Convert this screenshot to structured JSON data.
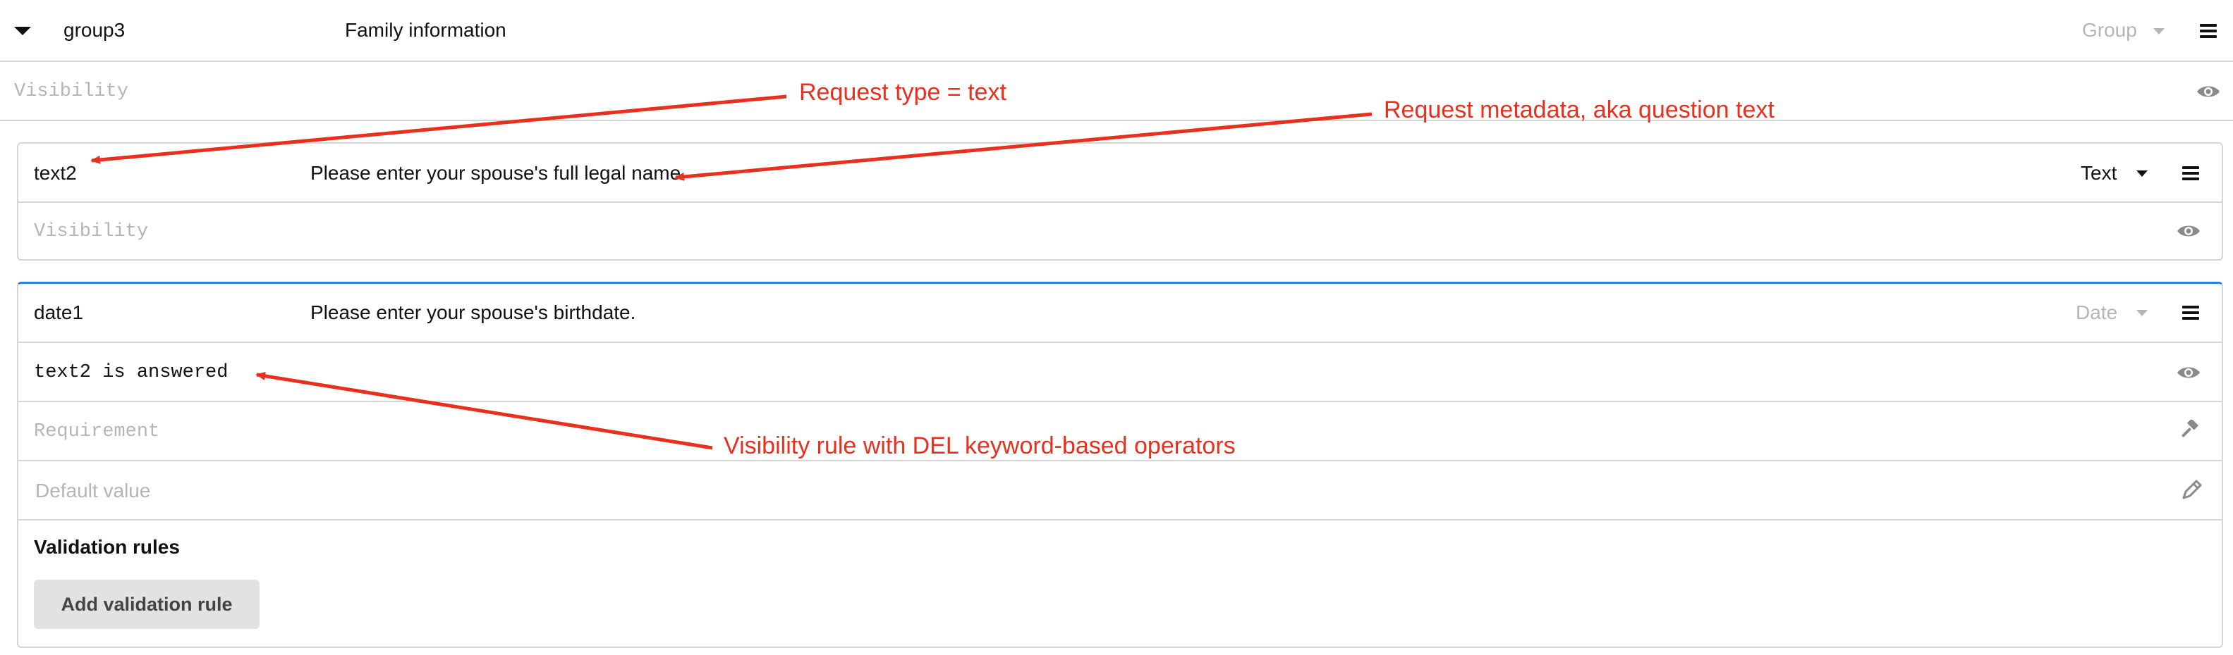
{
  "group": {
    "id": "group3",
    "title": "Family information",
    "type": "Group",
    "visibility_placeholder": "Visibility"
  },
  "questions": [
    {
      "id": "text2",
      "text": "Please enter your spouse's full legal name.",
      "type": "Text",
      "visibility_placeholder": "Visibility"
    },
    {
      "id": "date1",
      "text": "Please enter your spouse's birthdate.",
      "type": "Date",
      "visibility_value": "text2 is answered",
      "requirement_placeholder": "Requirement",
      "default_value_placeholder": "Default value",
      "validation_rules_heading": "Validation rules",
      "add_validation_rule_label": "Add validation rule"
    }
  ],
  "annotations": {
    "request_type": "Request type = text",
    "request_metadata": "Request metadata, aka question text",
    "visibility_rule": "Visibility rule with DEL keyword-based operators"
  },
  "icons": {
    "collapse": "caret-down-icon",
    "menu": "hamburger-menu-icon",
    "visibility": "eye-icon",
    "requirement": "gavel-icon",
    "default_value": "pencil-icon"
  },
  "colors": {
    "annotation": "#e8301f",
    "active_border": "#2b7fd6"
  }
}
